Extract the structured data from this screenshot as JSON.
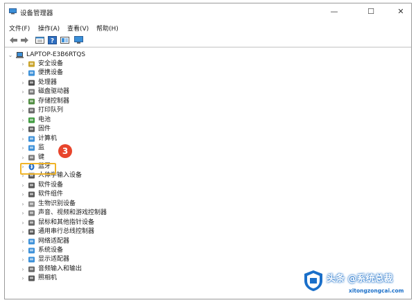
{
  "window": {
    "title": "设备管理器",
    "minimize": "—",
    "maximize": "☐",
    "close": "✕"
  },
  "menu": [
    "文件(F)",
    "操作(A)",
    "查看(V)",
    "帮助(H)"
  ],
  "toolbar_icons": [
    "back-arrow-icon",
    "forward-arrow-icon",
    "properties-icon",
    "help-icon",
    "update-driver-icon",
    "monitor-scan-icon"
  ],
  "tree": {
    "root": "LAPTOP-E3B6RTQS",
    "items": [
      {
        "label": "安全设备",
        "icon": "security-device-icon"
      },
      {
        "label": "便携设备",
        "icon": "portable-device-icon"
      },
      {
        "label": "处理器",
        "icon": "processor-icon"
      },
      {
        "label": "磁盘驱动器",
        "icon": "disk-drive-icon"
      },
      {
        "label": "存储控制器",
        "icon": "storage-controller-icon"
      },
      {
        "label": "打印队列",
        "icon": "printer-icon"
      },
      {
        "label": "电池",
        "icon": "battery-icon"
      },
      {
        "label": "固件",
        "icon": "firmware-icon"
      },
      {
        "label": "计算机",
        "icon": "computer-icon"
      },
      {
        "label": "监",
        "icon": "monitor-icon"
      },
      {
        "label": "键",
        "icon": "keyboard-icon"
      },
      {
        "label": "蓝牙",
        "icon": "bluetooth-icon"
      },
      {
        "label": "人体学输入设备",
        "icon": "hid-icon"
      },
      {
        "label": "软件设备",
        "icon": "software-device-icon"
      },
      {
        "label": "软件组件",
        "icon": "software-component-icon"
      },
      {
        "label": "生物识别设备",
        "icon": "biometric-icon"
      },
      {
        "label": "声音、视频和游戏控制器",
        "icon": "sound-icon"
      },
      {
        "label": "鼠标和其他指针设备",
        "icon": "mouse-icon"
      },
      {
        "label": "通用串行总线控制器",
        "icon": "usb-icon"
      },
      {
        "label": "网络适配器",
        "icon": "network-adapter-icon"
      },
      {
        "label": "系统设备",
        "icon": "system-device-icon"
      },
      {
        "label": "显示适配器",
        "icon": "display-adapter-icon"
      },
      {
        "label": "音频输入和输出",
        "icon": "audio-icon"
      },
      {
        "label": "照相机",
        "icon": "camera-icon"
      }
    ]
  },
  "callout": {
    "number": "3"
  },
  "watermark": {
    "line1": "头条 @系统总裁",
    "line2": "xitongzongcai.com"
  },
  "colors": {
    "highlight": "#f0b428",
    "badge": "#e8452c",
    "watermark": "#1a6fc9"
  }
}
